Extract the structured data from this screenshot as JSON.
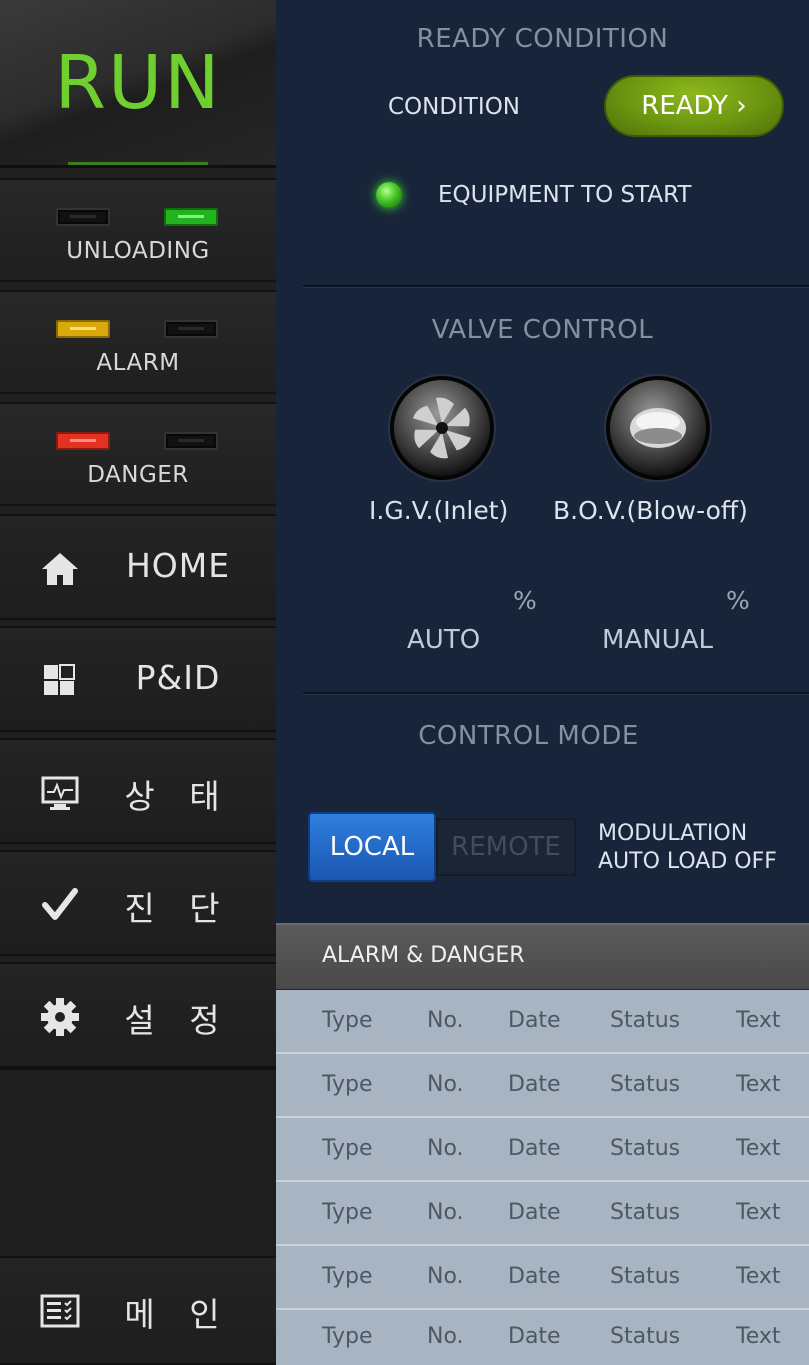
{
  "sidebar": {
    "run_label": "RUN",
    "status_blocks": [
      {
        "label": "UNLOADING",
        "lamps": [
          "off",
          "green"
        ]
      },
      {
        "label": "ALARM",
        "lamps": [
          "yellow",
          "off"
        ]
      },
      {
        "label": "DANGER",
        "lamps": [
          "red",
          "off"
        ]
      }
    ],
    "nav": [
      {
        "label": "HOME",
        "icon": "home-icon"
      },
      {
        "label": "P&ID",
        "icon": "grid-icon"
      },
      {
        "label": "상 태",
        "icon": "monitor-icon"
      },
      {
        "label": "진 단",
        "icon": "checkmark-icon"
      },
      {
        "label": "설 정",
        "icon": "gear-icon"
      }
    ],
    "main_nav": {
      "label": "메 인",
      "icon": "list-icon"
    }
  },
  "ready_condition": {
    "title": "READY CONDITION",
    "condition_label": "CONDITION",
    "ready_button": "READY ›",
    "indicator_label": "EQUIPMENT TO START",
    "indicator_color": "#3fc424"
  },
  "valve_control": {
    "title": "VALVE CONTROL",
    "igv_label": "I.G.V.(Inlet)",
    "bov_label": "B.O.V.(Blow-off)",
    "igv_unit": "%",
    "bov_unit": "%",
    "auto_label": "AUTO",
    "manual_label": "MANUAL"
  },
  "control_mode": {
    "title": "CONTROL MODE",
    "local_label": "LOCAL",
    "remote_label": "REMOTE",
    "modulation_line1": "MODULATION",
    "modulation_line2": "AUTO LOAD OFF",
    "active": "LOCAL"
  },
  "alarm_section": {
    "title": "ALARM & DANGER",
    "rows": [
      [
        "Type",
        "No.",
        "Date",
        "Status",
        "Text"
      ],
      [
        "Type",
        "No.",
        "Date",
        "Status",
        "Text"
      ],
      [
        "Type",
        "No.",
        "Date",
        "Status",
        "Text"
      ],
      [
        "Type",
        "No.",
        "Date",
        "Status",
        "Text"
      ],
      [
        "Type",
        "No.",
        "Date",
        "Status",
        "Text"
      ],
      [
        "Type",
        "No.",
        "Date",
        "Status",
        "Text"
      ]
    ]
  },
  "colors": {
    "run": "#6fcf2e",
    "ready_button": "#7aa414",
    "local_button": "#2567c8",
    "panel_bg": "#18243a"
  }
}
